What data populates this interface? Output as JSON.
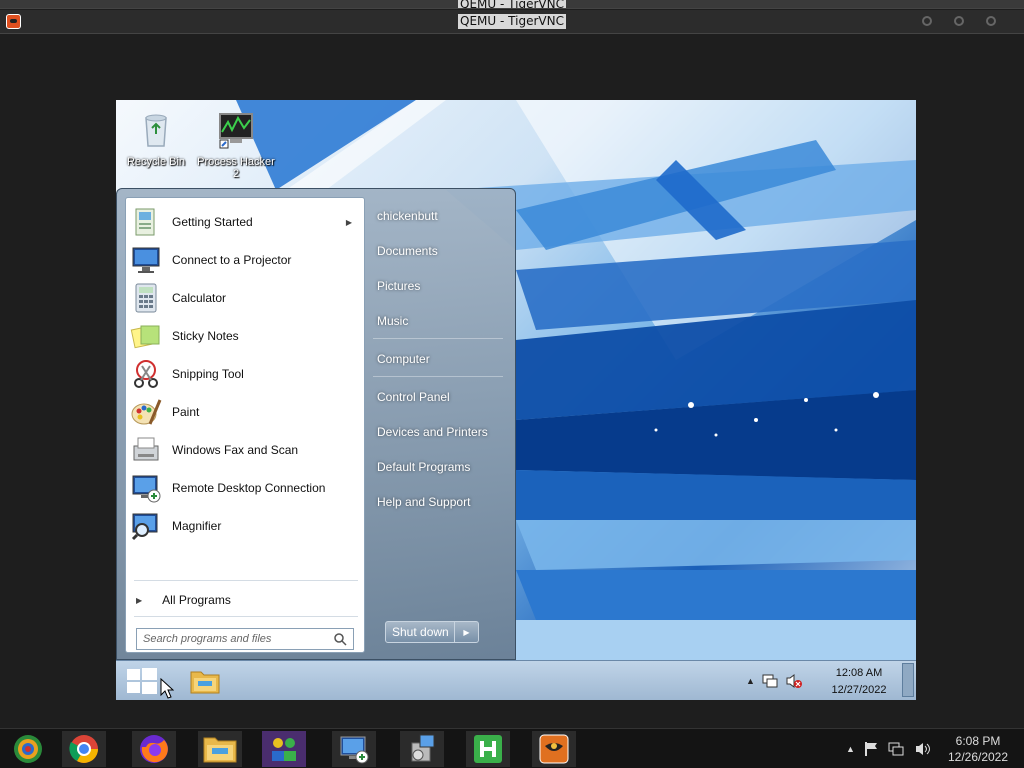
{
  "host": {
    "window_title": "QEMU - TigerVNC",
    "back_title": "QEMU - TigerVNC"
  },
  "desktop": {
    "icons": [
      {
        "label": "Recycle Bin",
        "icon": "recycle-bin-icon"
      },
      {
        "label": "Process Hacker 2",
        "icon": "process-hacker-icon"
      }
    ]
  },
  "start_menu": {
    "programs": [
      {
        "label": "Getting Started",
        "icon": "getting-started-icon",
        "has_submenu": true
      },
      {
        "label": "Connect to a Projector",
        "icon": "projector-icon"
      },
      {
        "label": "Calculator",
        "icon": "calculator-icon"
      },
      {
        "label": "Sticky Notes",
        "icon": "sticky-notes-icon"
      },
      {
        "label": "Snipping Tool",
        "icon": "snipping-tool-icon"
      },
      {
        "label": "Paint",
        "icon": "paint-icon"
      },
      {
        "label": "Windows Fax and Scan",
        "icon": "fax-scan-icon"
      },
      {
        "label": "Remote Desktop Connection",
        "icon": "remote-desktop-icon"
      },
      {
        "label": "Magnifier",
        "icon": "magnifier-icon"
      }
    ],
    "all_programs": "All Programs",
    "search_placeholder": "Search programs and files",
    "right_items": [
      "chickenbutt",
      "Documents",
      "Pictures",
      "Music",
      "Computer",
      "Control Panel",
      "Devices and Printers",
      "Default Programs",
      "Help and Support"
    ],
    "shutdown": "Shut down"
  },
  "vm_taskbar": {
    "time": "12:08 AM",
    "date": "12/27/2022"
  },
  "host_taskbar": {
    "apps": [
      "app-launcher-icon",
      "chrome-icon",
      "firefox-icon",
      "file-manager-icon",
      "network-app-icon",
      "remote-desktop-icon",
      "installer-icon",
      "h-app-icon",
      "tigervnc-icon"
    ],
    "time": "6:08 PM",
    "date": "12/26/2022"
  }
}
